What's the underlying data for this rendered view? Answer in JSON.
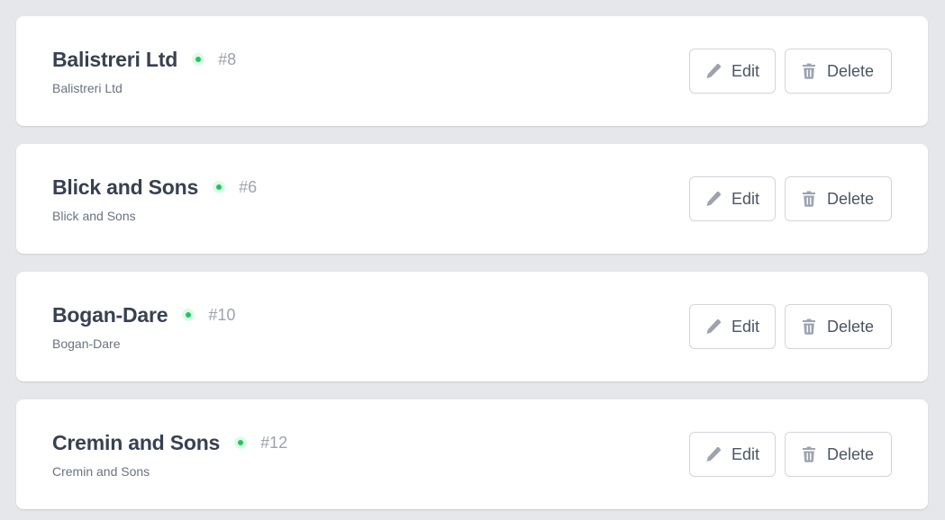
{
  "buttons": {
    "edit_label": "Edit",
    "delete_label": "Delete",
    "edit_icon": "pencil-icon",
    "delete_icon": "trash-icon"
  },
  "colors": {
    "status_active": "#22c55e",
    "card_bg": "#ffffff",
    "page_bg": "#e5e7eb"
  },
  "companies": [
    {
      "name": "Balistreri Ltd",
      "id": "#8",
      "subtitle": "Balistreri Ltd",
      "status": "active"
    },
    {
      "name": "Blick and Sons",
      "id": "#6",
      "subtitle": "Blick and Sons",
      "status": "active"
    },
    {
      "name": "Bogan-Dare",
      "id": "#10",
      "subtitle": "Bogan-Dare",
      "status": "active"
    },
    {
      "name": "Cremin and Sons",
      "id": "#12",
      "subtitle": "Cremin and Sons",
      "status": "active"
    }
  ]
}
